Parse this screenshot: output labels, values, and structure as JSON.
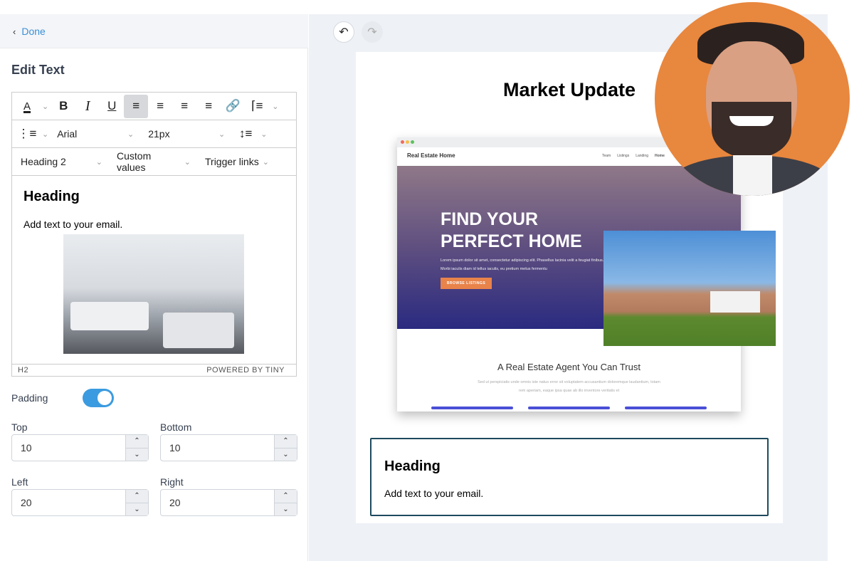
{
  "header": {
    "back_label": "Done"
  },
  "panel": {
    "title": "Edit Text"
  },
  "toolbar": {
    "font_family": "Arial",
    "font_size": "21px",
    "block_format": "Heading 2",
    "custom_values": "Custom values",
    "trigger_links": "Trigger links"
  },
  "editor": {
    "heading": "Heading",
    "body": "Add text to your email.",
    "status_path": "H2",
    "powered_by": "POWERED BY TINY"
  },
  "padding": {
    "label": "Padding",
    "enabled": true,
    "top_label": "Top",
    "top_value": "10",
    "bottom_label": "Bottom",
    "bottom_value": "10",
    "left_label": "Left",
    "left_value": "20",
    "right_label": "Right",
    "right_value": "20"
  },
  "preview": {
    "title": "Market Update",
    "site": {
      "brand": "Real Estate Home",
      "nav": [
        "Team",
        "Listings",
        "Landing",
        "Home"
      ],
      "hero_line1": "FIND YOUR",
      "hero_line2": "PERFECT HOME",
      "hero_text": "Lorem ipsum dolor sit amet, consectetur adipiscing elit. Phasellus lacinia velit a feugiat finibus. Morbi iaculis diam id tellus iaculis, eu pretium metus fermentu",
      "cta": "BROWSE LISTINGS",
      "section_title": "A Real Estate Agent You Can Trust",
      "section_text": "Sed ut perspiciatis unde omnis iste natus error sit voluptatem accusantium doloremque laudantium, totam rem aperiam, eaque ipsa quae ab illo inventore veritatis et"
    },
    "block_heading": "Heading",
    "block_body": "Add text to your email."
  },
  "colors": {
    "accent": "#3b8fd6",
    "toggle": "#3b9be0",
    "avatar_bg": "#e8873e",
    "selection_border": "#1e4a5e"
  }
}
